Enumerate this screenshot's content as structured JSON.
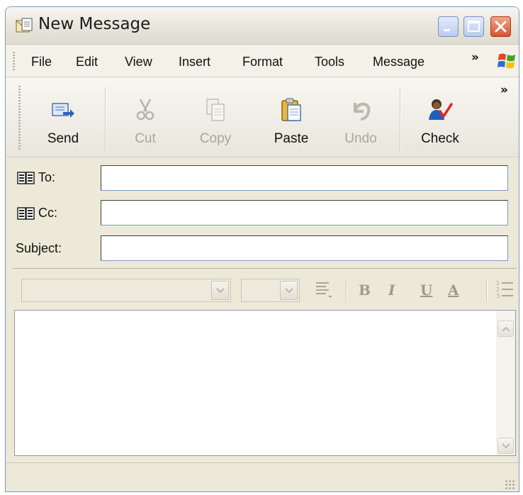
{
  "window": {
    "title": "New Message"
  },
  "menubar": {
    "items": [
      "File",
      "Edit",
      "View",
      "Insert",
      "Format",
      "Tools",
      "Message"
    ],
    "overflow": "»"
  },
  "toolbar": {
    "buttons": [
      {
        "label": "Send",
        "icon": "send-icon",
        "enabled": true
      },
      {
        "label": "Cut",
        "icon": "scissors-icon",
        "enabled": false
      },
      {
        "label": "Copy",
        "icon": "copy-icon",
        "enabled": false
      },
      {
        "label": "Paste",
        "icon": "clipboard-icon",
        "enabled": true
      },
      {
        "label": "Undo",
        "icon": "undo-icon",
        "enabled": false
      },
      {
        "label": "Check",
        "icon": "check-names-icon",
        "enabled": true
      }
    ],
    "overflow": "»"
  },
  "fields": {
    "to": {
      "label": "To:",
      "value": ""
    },
    "cc": {
      "label": "Cc:",
      "value": ""
    },
    "subject": {
      "label": "Subject:",
      "value": ""
    }
  },
  "format": {
    "font_name": "",
    "font_size": "",
    "bold": "B",
    "italic": "I",
    "underline": "U",
    "font_color": "A"
  },
  "body": {
    "text": ""
  },
  "status": {
    "text": ""
  }
}
